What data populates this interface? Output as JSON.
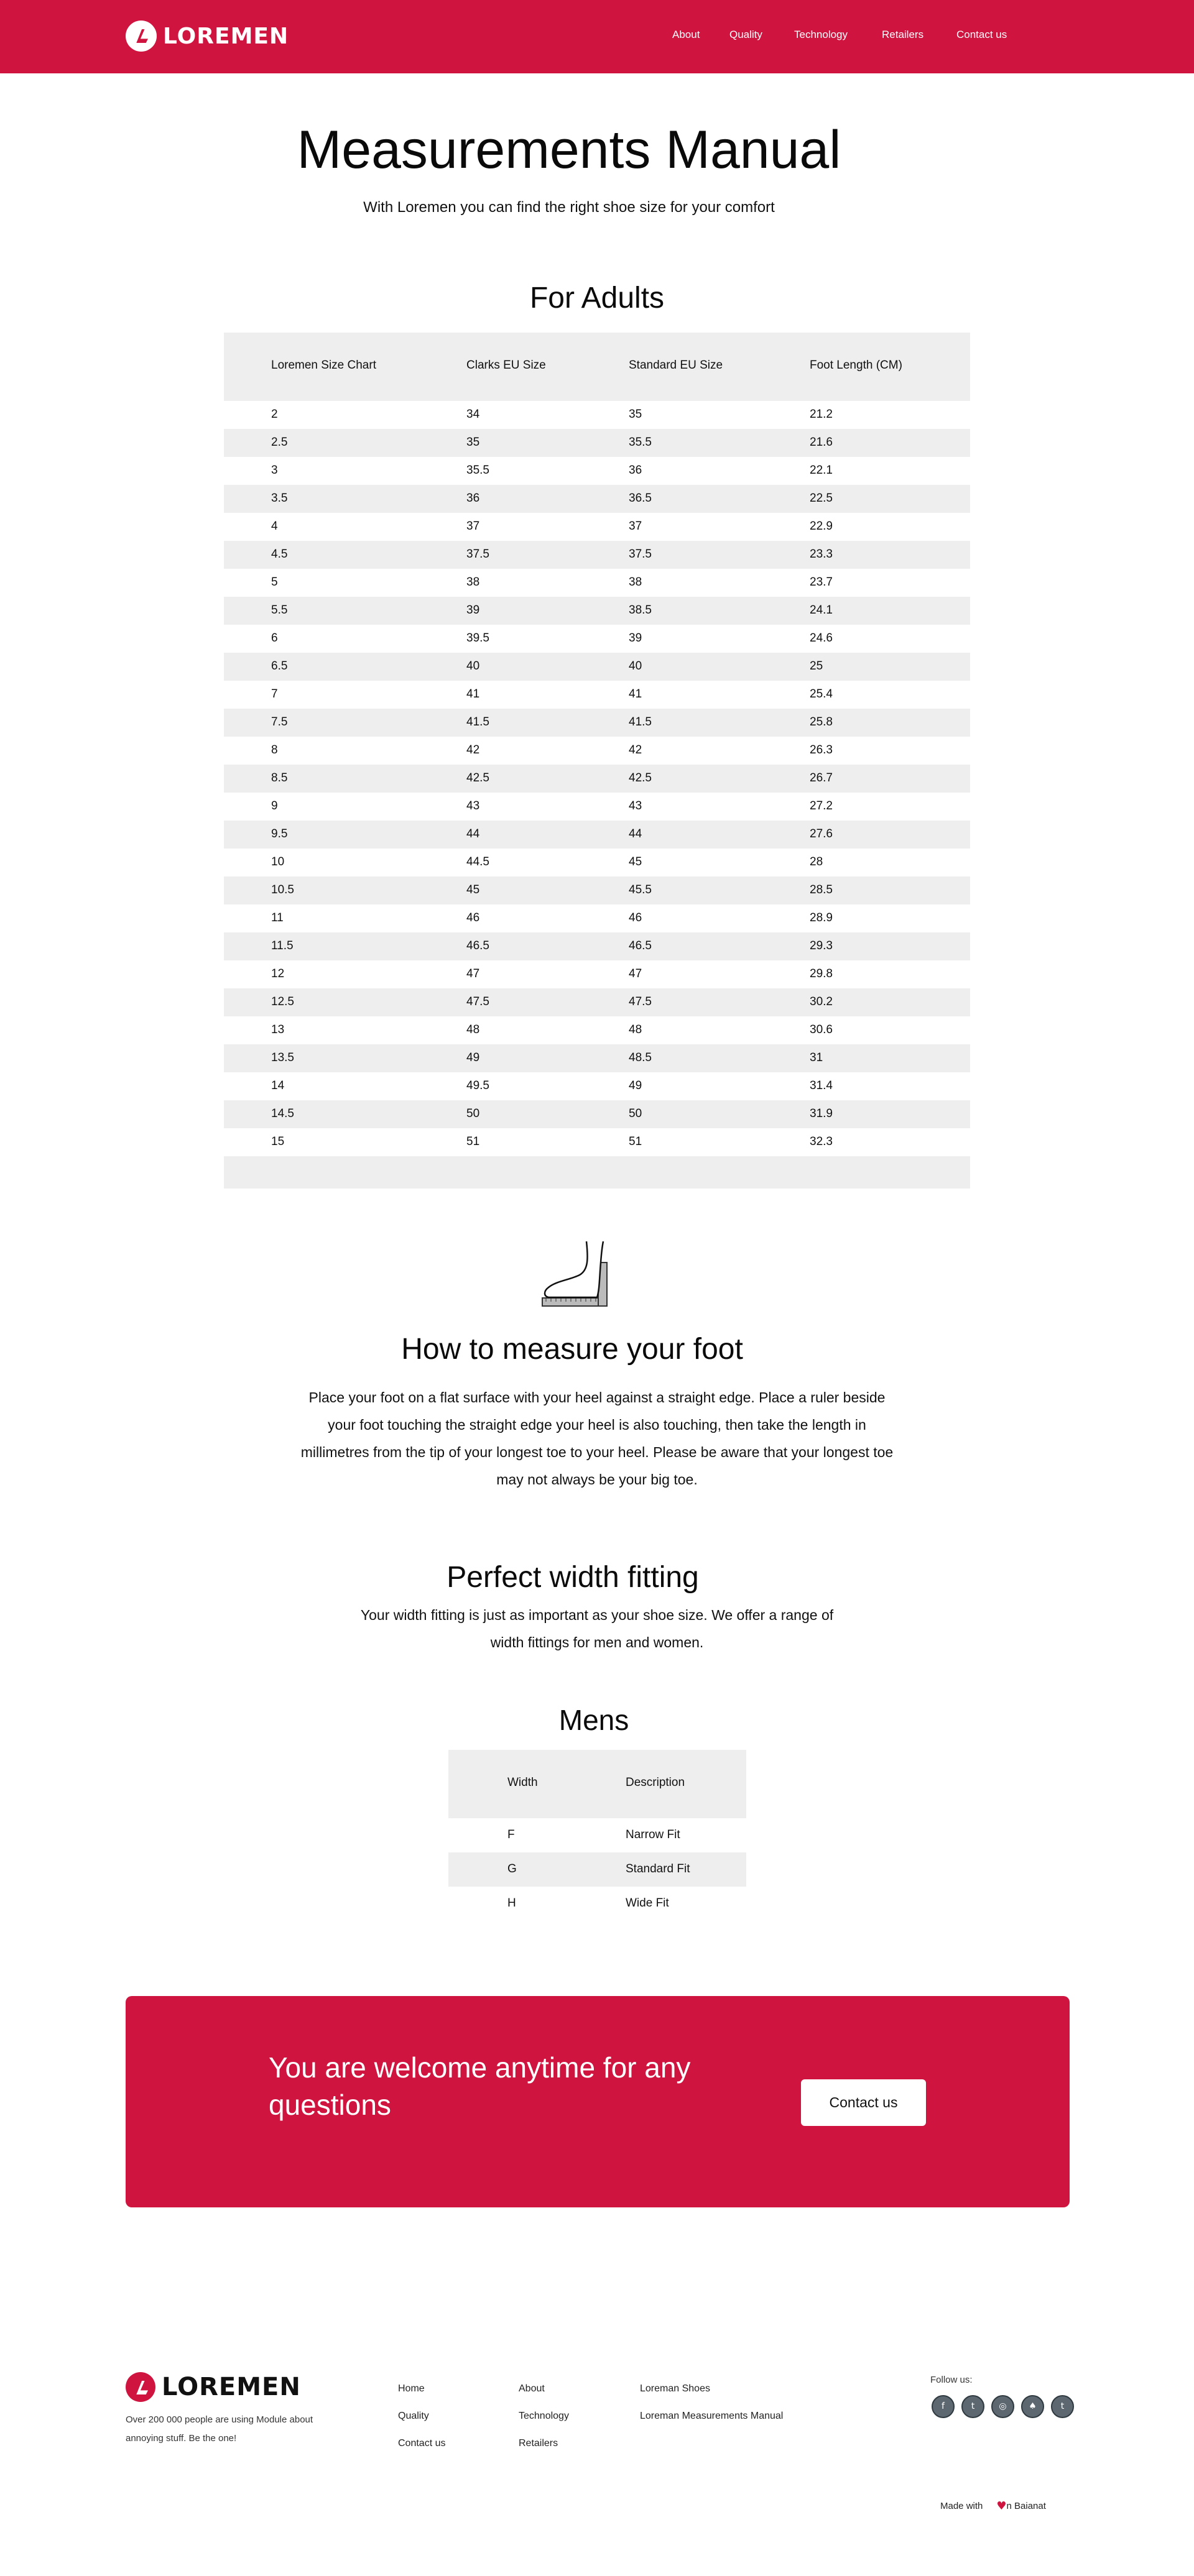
{
  "brand": {
    "name": "LOREMEN",
    "color": "#cf1440"
  },
  "nav": [
    {
      "label": "About"
    },
    {
      "label": "Quality"
    },
    {
      "label": "Technology"
    },
    {
      "label": "Retailers"
    },
    {
      "label": "Contact us"
    }
  ],
  "hero": {
    "title": "Measurements Manual",
    "subtitle": "With Loremen you can find the right shoe size for your comfort"
  },
  "adults": {
    "title": "For Adults",
    "headers": [
      "Loremen Size Chart",
      "Clarks EU Size",
      "Standard EU Size",
      "Foot Length (CM)"
    ],
    "rows": [
      [
        "2",
        "34",
        "35",
        "21.2"
      ],
      [
        "2.5",
        "35",
        "35.5",
        "21.6"
      ],
      [
        "3",
        "35.5",
        "36",
        "22.1"
      ],
      [
        "3.5",
        "36",
        "36.5",
        "22.5"
      ],
      [
        "4",
        "37",
        "37",
        "22.9"
      ],
      [
        "4.5",
        "37.5",
        "37.5",
        "23.3"
      ],
      [
        "5",
        "38",
        "38",
        "23.7"
      ],
      [
        "5.5",
        "39",
        "38.5",
        "24.1"
      ],
      [
        "6",
        "39.5",
        "39",
        "24.6"
      ],
      [
        "6.5",
        "40",
        "40",
        "25"
      ],
      [
        "7",
        "41",
        "41",
        "25.4"
      ],
      [
        "7.5",
        "41.5",
        "41.5",
        "25.8"
      ],
      [
        "8",
        "42",
        "42",
        "26.3"
      ],
      [
        "8.5",
        "42.5",
        "42.5",
        "26.7"
      ],
      [
        "9",
        "43",
        "43",
        "27.2"
      ],
      [
        "9.5",
        "44",
        "44",
        "27.6"
      ],
      [
        "10",
        "44.5",
        "45",
        "28"
      ],
      [
        "10.5",
        "45",
        "45.5",
        "28.5"
      ],
      [
        "11",
        "46",
        "46",
        "28.9"
      ],
      [
        "11.5",
        "46.5",
        "46.5",
        "29.3"
      ],
      [
        "12",
        "47",
        "47",
        "29.8"
      ],
      [
        "12.5",
        "47.5",
        "47.5",
        "30.2"
      ],
      [
        "13",
        "48",
        "48",
        "30.6"
      ],
      [
        "13.5",
        "49",
        "48.5",
        "31"
      ],
      [
        "14",
        "49.5",
        "49",
        "31.4"
      ],
      [
        "14.5",
        "50",
        "50",
        "31.9"
      ],
      [
        "15",
        "51",
        "51",
        "32.3"
      ]
    ]
  },
  "measure": {
    "icon": "foot-ruler-icon",
    "title": "How to measure your foot",
    "text": "Place your foot on a flat surface with your heel against a straight edge. Place a ruler beside your foot touching the straight edge your heel is also touching, then take the length in millimetres from the tip of your longest toe to your heel. Please be aware that your longest toe may not always be your big toe."
  },
  "width_fitting": {
    "title": "Perfect width fitting",
    "text": "Your width fitting is just as important as your shoe size. We offer a range of width fittings for men and women."
  },
  "mens": {
    "title": "Mens",
    "headers": [
      "Width",
      "Description"
    ],
    "rows": [
      [
        "F",
        "Narrow Fit"
      ],
      [
        "G",
        "Standard Fit"
      ],
      [
        "H",
        "Wide Fit"
      ]
    ]
  },
  "cta": {
    "text": "You are welcome anytime for any questions",
    "button": "Contact us"
  },
  "footer": {
    "about": "Over 200 000 people are using Module about annoying stuff. Be the one!",
    "col1": [
      "Home",
      "Quality",
      "Contact us"
    ],
    "col2": [
      "About",
      "Technology",
      "Retailers"
    ],
    "col3": [
      "Loreman Shoes",
      "Loreman Measurements Manual"
    ],
    "follow": "Follow us:",
    "socials": [
      {
        "icon": "facebook-icon",
        "glyph": "f"
      },
      {
        "icon": "twitter-icon",
        "glyph": "t"
      },
      {
        "icon": "instagram-icon",
        "glyph": "◎"
      },
      {
        "icon": "snapchat-icon",
        "glyph": "♠"
      },
      {
        "icon": "twitter-icon",
        "glyph": "t"
      }
    ],
    "made_with": "Made with",
    "made_by": "n Baianat"
  }
}
